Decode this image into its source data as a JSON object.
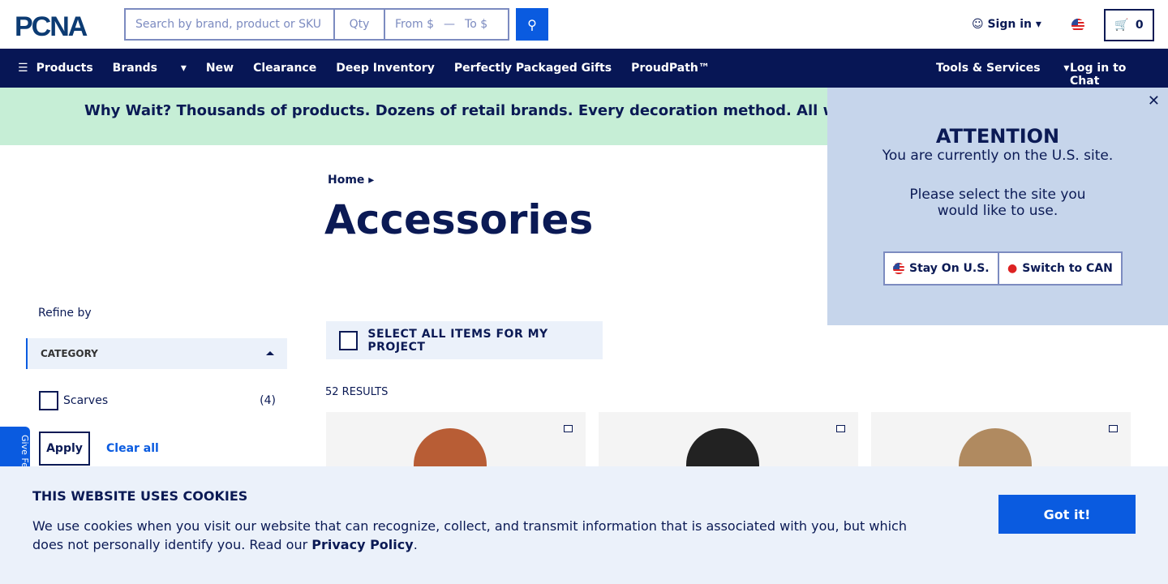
{
  "header": {
    "logo": "PCNA",
    "search_placeholder": "Search by brand, product or SKU",
    "qty_placeholder": "Qty",
    "from_placeholder": "From $",
    "dash": "—",
    "to_placeholder": "To $",
    "sign_in": "Sign in",
    "cart_count": "0"
  },
  "nav": {
    "items": [
      "Products",
      "Brands",
      "New",
      "Clearance",
      "Deep Inventory",
      "Perfectly Packaged Gifts",
      "ProudPath™"
    ],
    "tools": "Tools & Services",
    "chat": "Log in to Chat"
  },
  "banner": "Why Wait? Thousands of products. Dozens of retail brands. Every decoration method. All with a standard",
  "breadcrumb": "Home",
  "title": "Accessories",
  "filters": {
    "refine": "Refine by",
    "category": "CATEGORY",
    "option": "Scarves",
    "count": "(4)",
    "apply": "Apply",
    "clear": "Clear all"
  },
  "feedback": "Give Fe",
  "select_all": "SELECT ALL ITEMS FOR MY PROJECT",
  "results": "52 RESULTS",
  "popup": {
    "title": "ATTENTION",
    "line1": "You are currently on the U.S. site.",
    "line2": "Please select the site you would like to use.",
    "stay": "Stay On U.S.",
    "switch": "Switch to CAN"
  },
  "cookies": {
    "title": "THIS WEBSITE USES COOKIES",
    "text": "We use cookies when you visit our website that can recognize, collect, and transmit information that is associated with you, but which does not personally identify you. Read our ",
    "link": "Privacy Policy",
    "end": ".",
    "button": "Got it!"
  }
}
